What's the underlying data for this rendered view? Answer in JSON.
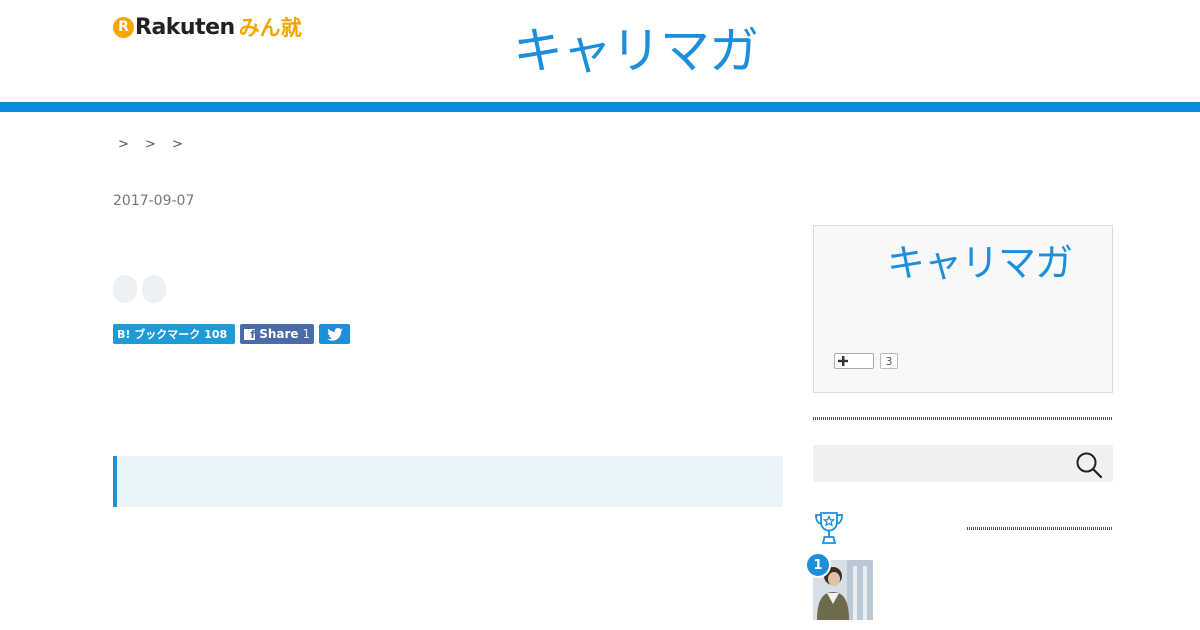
{
  "header": {
    "rakuten_badge": "R",
    "rakuten_text": "Rakuten",
    "minshu_text": "みん就",
    "site_logo": "キャリマガ"
  },
  "breadcrumb": {
    "separators": [
      ">",
      ">",
      ">"
    ]
  },
  "article": {
    "date": "2017-09-07"
  },
  "share": {
    "hatena_label": "B! ブックマーク",
    "hatena_count": "108",
    "fb_label": "Share",
    "fb_count": "1"
  },
  "sidebar": {
    "logo": "キャリマガ",
    "follow_count": "3"
  },
  "ranking": {
    "items": [
      {
        "rank": "1"
      }
    ]
  },
  "colors": {
    "accent": "#0a8be0",
    "logo_blue": "#1b8fdc",
    "rakuten_orange": "#f5a400",
    "hatena": "#1d9bd8",
    "facebook": "#4b6aa8",
    "twitter": "#1d8fdc"
  }
}
